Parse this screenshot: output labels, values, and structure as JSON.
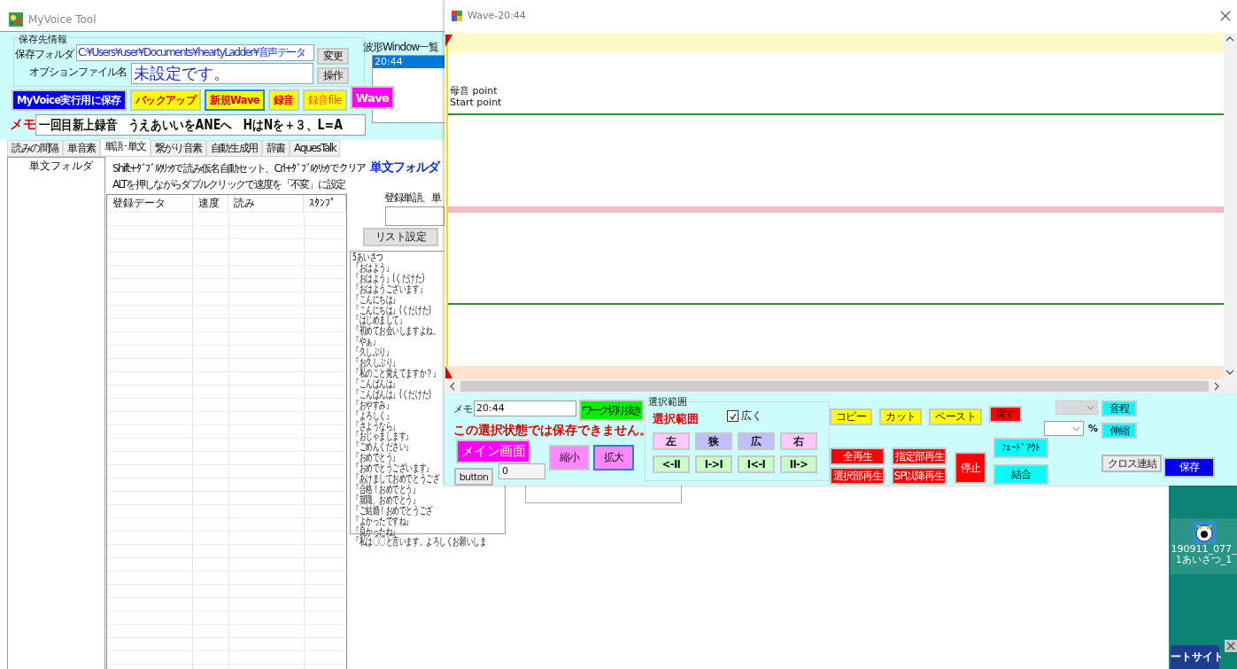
{
  "main_window": {
    "title": "MyVoice Tool",
    "save_info": {
      "group_label": "保存先情報",
      "folder_label": "保存フォルダ",
      "folder_value": "C:¥Users¥user¥Documents¥heartyLadder¥音声データ",
      "change_button": "変更",
      "option_label": "オプションファイル名",
      "option_value": "未設定です。",
      "operate_button": "操作"
    },
    "wave_list": {
      "label": "波形Window一覧",
      "items": [
        {
          "text": "20:44",
          "selected": true
        }
      ]
    },
    "action_buttons": [
      {
        "label": "MyVoice実行用に保存",
        "kind": "blue"
      },
      {
        "label": "バックアップ",
        "kind": "alert"
      },
      {
        "label": "新規Wave",
        "kind": "alertframed"
      },
      {
        "label": "録音",
        "kind": "alert"
      },
      {
        "label": "録音file",
        "kind": "file"
      },
      {
        "label": "Wave",
        "kind": "magenta"
      }
    ],
    "memo": {
      "label": "メモ",
      "value": "一回目新上録音　うえあいいをANEへ　HはNを＋３、L=A"
    },
    "tabs": [
      {
        "label": "読みの間隔",
        "selected": false
      },
      {
        "label": "単音素",
        "selected": false
      },
      {
        "label": "単語･単文",
        "selected": true
      },
      {
        "label": "繋がり音素",
        "selected": false
      },
      {
        "label": "自動生成用",
        "selected": false
      },
      {
        "label": "辞書",
        "selected": false
      },
      {
        "label": "AquesTalk",
        "selected": false
      }
    ],
    "tree": {
      "items": [
        {
          "label": "単文フォルダ"
        }
      ]
    },
    "hint_lines": [
      "Shift+ﾀﾞﾌﾞﾙｸﾘｯｸで読み仮名自動セット、Crl+ﾀﾞﾌﾞﾙｸﾘｯｸでクリア",
      "ALTを押しながらダブルクリックで速度を「不変」に設定"
    ],
    "table": {
      "columns": [
        "登録データ",
        "速度",
        "読み",
        "ｽﾀﾝﾌﾟ"
      ]
    },
    "folder_title": "単文フォルダ",
    "entry_label": "登録単語、単",
    "list_settings_button": "リスト設定",
    "phrases": [
      "5あいさつ",
      "『おはよう』",
      "『おはよう』(くだけた)",
      "『おはようございます』",
      "『こんにちは』",
      "『こんにちは』(くだけた)",
      "『はじめまして』",
      "『初めてお会いしますよね。",
      "『やぁ』",
      "『久しぶり』",
      "『お久しぶり』",
      "『私のこと覚えてますか？』",
      "『こんばんは』",
      "『こんばんは』(くだけた)",
      "『おやすみ』",
      "『よろしく』",
      "『さようなら』",
      "『おじゃまします』",
      "『ごめんください』",
      "『おめでとう』",
      "『おめでとうございます』",
      "『あけましておめでとうござ",
      "『合格！おめでとう』",
      "『就職、おめでとう』",
      "『ご結婚！おめでとうござ",
      "『よかったですね』",
      "『良かったね』",
      "『私は〇〇と言います。よろしくお願いしま"
    ]
  },
  "wave_window": {
    "title": "Wave-20:44",
    "markers": [
      "母音 point",
      "Start point"
    ],
    "memo_label": "メモ",
    "memo_value": "20:44",
    "cut_button": {
      "label": "ワーク切り抜き",
      "kind": "green"
    },
    "warning": "この選択状態では保存できません。",
    "main_button": {
      "label": "メイン画面",
      "kind": "magenta"
    },
    "zoom_buttons": [
      {
        "label": "縮小",
        "kind": "pink"
      },
      {
        "label": "拡大",
        "kind": "pinkframed"
      }
    ],
    "count_value": "0",
    "overlay_button": "button",
    "range": {
      "group_label": "選択範囲",
      "title": "選択範囲",
      "wide": {
        "label": "広く",
        "checked": true
      },
      "buttons": [
        {
          "label": "左",
          "kind": "rose"
        },
        {
          "label": "狭",
          "kind": "lavender"
        },
        {
          "label": "広",
          "kind": "lavender"
        },
        {
          "label": "右",
          "kind": "rose"
        },
        {
          "label": "<-II",
          "kind": "mint"
        },
        {
          "label": "I->I",
          "kind": "mint"
        },
        {
          "label": "I<-I",
          "kind": "mint"
        },
        {
          "label": "II->",
          "kind": "mint"
        }
      ]
    },
    "edit_buttons": [
      {
        "label": "コピー",
        "kind": "yellow"
      },
      {
        "label": "カット",
        "kind": "yellow"
      },
      {
        "label": "ペースト",
        "kind": "yellow"
      },
      {
        "label": "戻す",
        "kind": "red"
      }
    ],
    "pitch_button": {
      "label": "音程",
      "kind": "cyan"
    },
    "percent_label": "%",
    "stretch_button": {
      "label": "伸縮",
      "kind": "cyan"
    },
    "play_buttons": [
      {
        "label": "全再生",
        "kind": "red"
      },
      {
        "label": "指定部再生",
        "kind": "red"
      },
      {
        "label": "選択部再生",
        "kind": "red"
      },
      {
        "label": "SP以降再生",
        "kind": "red"
      }
    ],
    "stop_button": {
      "label": "停止",
      "kind": "red"
    },
    "fade_button": {
      "label": "ﾌｪｰﾄﾞｱｳﾄ",
      "kind": "cyan"
    },
    "join_button": {
      "label": "結合",
      "kind": "cyan"
    },
    "cross_button": {
      "label": "クロス連結",
      "kind": "grey"
    },
    "save_button": {
      "label": "保存",
      "kind": "blue"
    }
  },
  "desktop": {
    "icon_label": "190911_077_1あいさつ_1",
    "taskbar_button": "ートサイト"
  }
}
